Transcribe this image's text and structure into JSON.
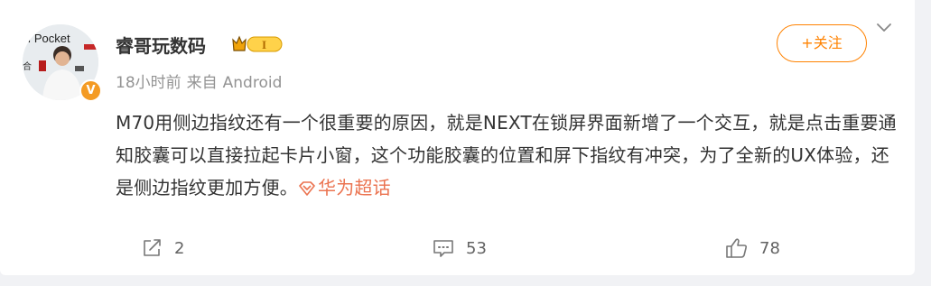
{
  "post": {
    "author": {
      "name": "睿哥玩数码",
      "avatar_icon": "person-avatar",
      "verified_icon": "verified-v-icon",
      "level_icon": "level-badge-icon",
      "level_text": "I"
    },
    "meta": {
      "time": "18小时前",
      "source_label": "来自",
      "source": "Android"
    },
    "follow_label": "+关注",
    "content": {
      "text": "M70用侧边指纹还有一个很重要的原因，就是NEXT在锁屏界面新增了一个交互，就是点击重要通知胶囊可以直接拉起卡片小窗，这个功能胶囊的位置和屏下指纹有冲突，为了全新的UX体验，还是侧边指纹更加方便。",
      "topic_link": "华为超话"
    },
    "actions": {
      "share_count": "2",
      "comment_count": "53",
      "like_count": "78"
    },
    "colors": {
      "accent": "#ff8200",
      "link": "#eb7350",
      "text": "#333333",
      "muted": "#939393"
    }
  }
}
